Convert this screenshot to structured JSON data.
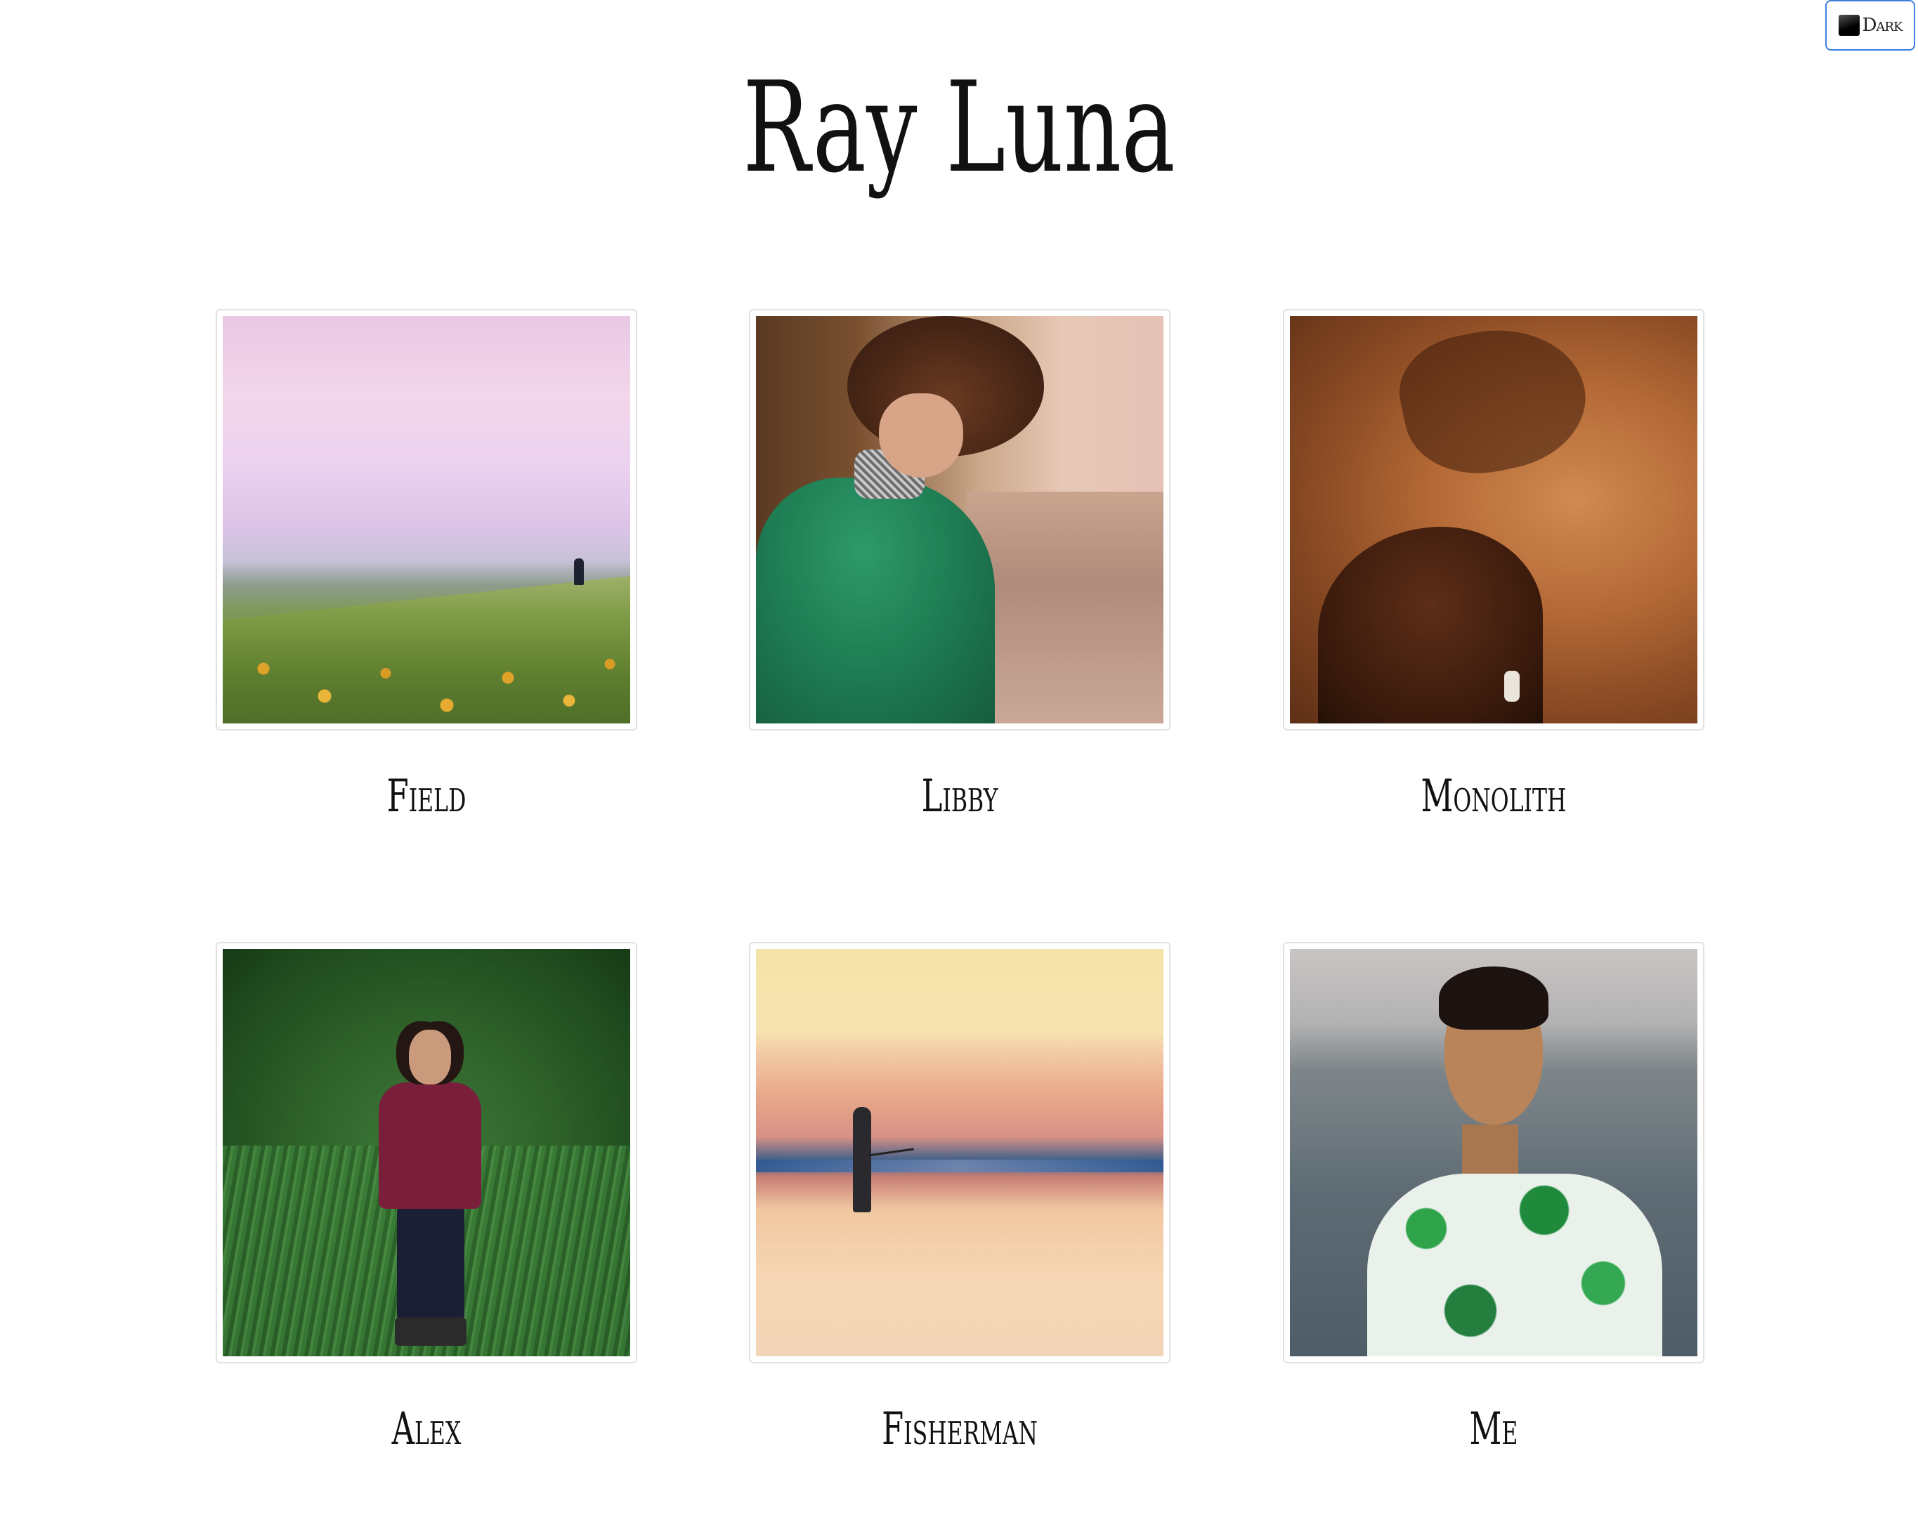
{
  "theme_toggle": {
    "label": "Dark"
  },
  "site": {
    "title": "Ray Luna"
  },
  "gallery": {
    "items": [
      {
        "caption": "Field"
      },
      {
        "caption": "Libby"
      },
      {
        "caption": "Monolith"
      },
      {
        "caption": "Alex"
      },
      {
        "caption": "Fisherman"
      },
      {
        "caption": "Me"
      }
    ]
  }
}
